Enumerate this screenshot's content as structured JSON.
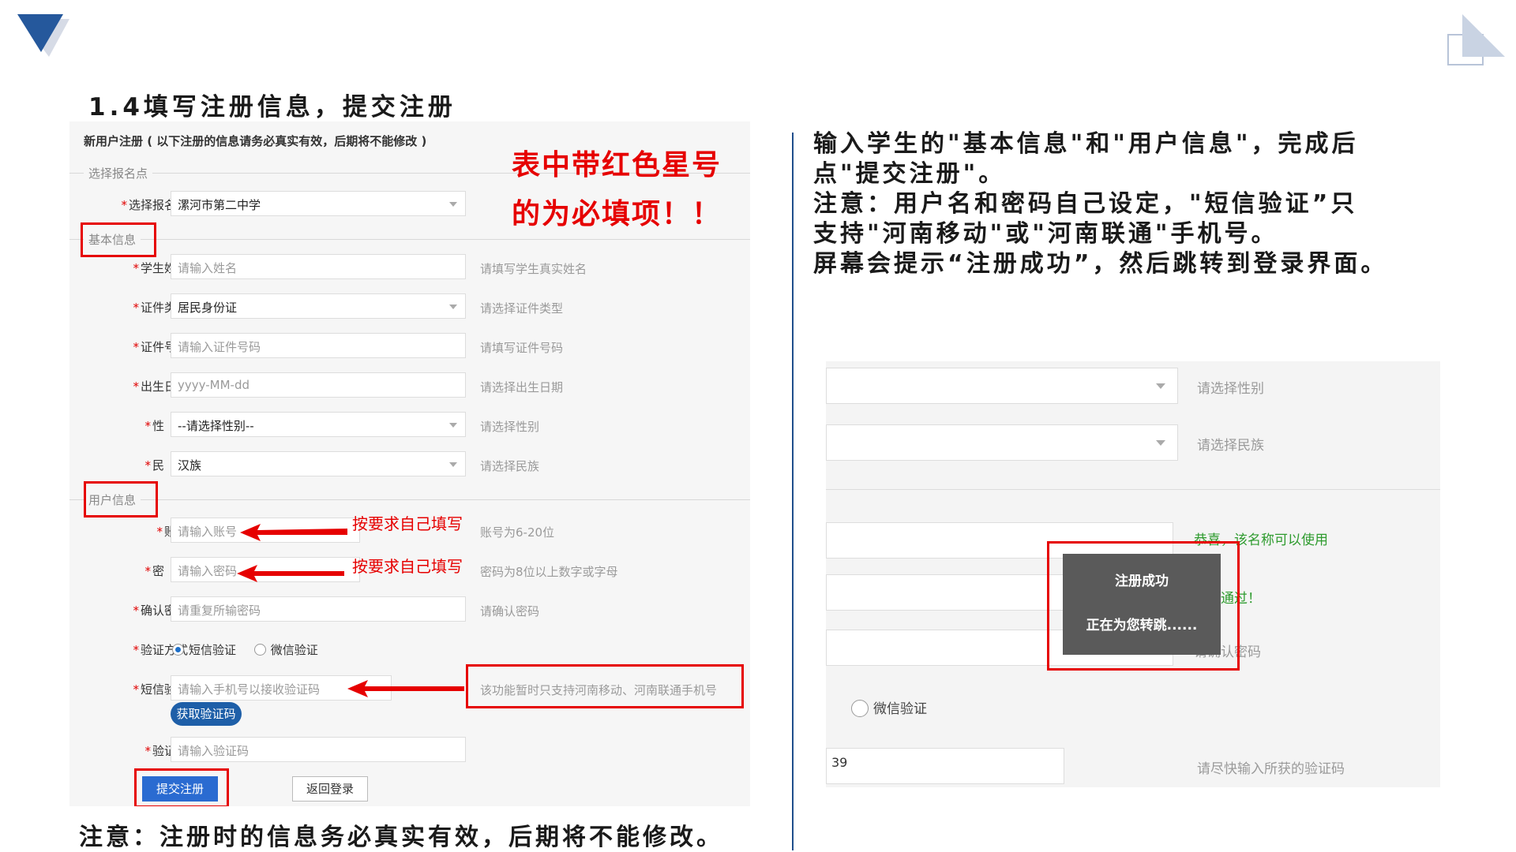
{
  "slide": {
    "heading": "1.4填写注册信息，提交注册",
    "bottom_note": "注意：注册时的信息务必真实有效，后期将不能修改。",
    "instructions": [
      "输入学生的\"基本信息\"和\"用户信息\"，完成后",
      "点\"提交注册\"。",
      "注意：用户名和密码自己设定，\"短信验证”只",
      "支持\"河南移动\"或\"河南联通\"手机号。",
      "屏幕会提示“注册成功”，然后跳转到登录界面。"
    ]
  },
  "form": {
    "title": "新用户注册 ( 以下注册的信息请务必真实有效，后期将不能修改 )",
    "sections": {
      "select_site": "选择报名点",
      "basic_info": "基本信息",
      "user_info": "用户信息"
    },
    "fields": {
      "site": {
        "label": "选择报名点",
        "value": "漯河市第二中学"
      },
      "name": {
        "label": "学生姓名",
        "placeholder": "请输入姓名",
        "hint": "请填写学生真实姓名"
      },
      "id_type": {
        "label": "证件类型",
        "value": "居民身份证",
        "hint": "请选择证件类型"
      },
      "id_number": {
        "label": "证件号码",
        "placeholder": "请输入证件号码",
        "hint": "请填写证件号码"
      },
      "birth": {
        "label": "出生日期",
        "placeholder": "yyyy-MM-dd",
        "hint": "请选择出生日期"
      },
      "gender": {
        "label": "性　别",
        "value": "--请选择性别--",
        "hint": "请选择性别"
      },
      "ethnicity": {
        "label": "民　族",
        "value": "汉族",
        "hint": "请选择民族"
      },
      "account": {
        "label": "账号",
        "placeholder": "请输入账号",
        "hint": "账号为6-20位"
      },
      "password": {
        "label": "密　码",
        "placeholder": "请输入密码",
        "hint": "密码为8位以上数字或字母"
      },
      "confirm": {
        "label": "确认密码",
        "placeholder": "请重复所输密码",
        "hint": "请确认密码"
      },
      "verify_method": {
        "label": "验证方式",
        "option_sms": "短信验证",
        "option_wechat": "微信验证",
        "selected": "短信验证"
      },
      "sms": {
        "label": "短信验证",
        "placeholder": "请输入手机号以接收验证码",
        "hint": "该功能暂时只支持河南移动、河南联通手机号"
      },
      "captcha": {
        "label": "验证码",
        "placeholder": "请输入验证码"
      }
    },
    "buttons": {
      "get_code": "获取验证码",
      "submit": "提交注册",
      "back": "返回登录"
    }
  },
  "annotations": {
    "required_note_line1": "表中带红色星号",
    "required_note_line2": "的为必填项！！",
    "fill_yourself_1": "按要求自己填写",
    "fill_yourself_2": "按要求自己填写",
    "required_mark": "*"
  },
  "success_screen": {
    "hint_gender": "请选择性别",
    "hint_ethnicity": "请选择民族",
    "name_ok": "恭喜，该名称可以使用",
    "check_ok": "校验通过！",
    "hint_confirm": "请确认密码",
    "wechat_option": "微信验证",
    "captcha_partial": "39",
    "hint_captcha": "请尽快输入所获的验证码",
    "toast_title": "注册成功",
    "toast_message": "正在为您转跳......"
  },
  "colors": {
    "accent_blue": "#1f4e8c",
    "required_red": "#e60000",
    "button_blue": "#2a6bd1",
    "success_green": "#2e9b2e"
  }
}
